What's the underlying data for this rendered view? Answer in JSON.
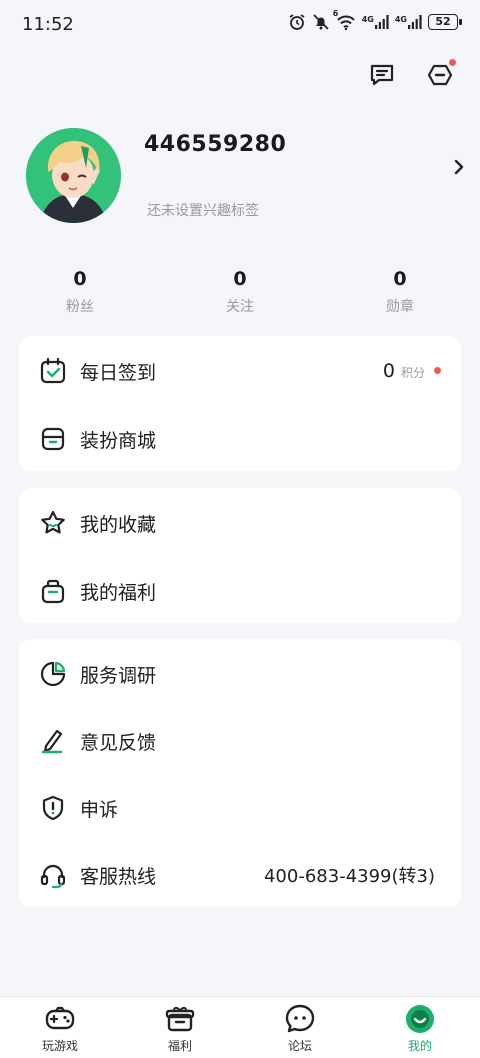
{
  "status_bar": {
    "time": "11:52",
    "battery": "52",
    "network_1": "4G",
    "network_2": "4G",
    "wifi_badge": "6"
  },
  "header": {
    "message_icon": "message-icon",
    "settings_icon": "settings-icon",
    "accent": "#18b06a",
    "badge_color": "#f05a55"
  },
  "profile": {
    "username": "446559280",
    "tagline": "还未设置兴趣标签",
    "avatar_bg": "#33c27a"
  },
  "stats": [
    {
      "value": "0",
      "label": "粉丝"
    },
    {
      "value": "0",
      "label": "关注"
    },
    {
      "value": "0",
      "label": "勋章"
    }
  ],
  "group1": {
    "checkin": {
      "label": "每日签到",
      "points": "0",
      "points_unit": "积分"
    },
    "dress": {
      "label": "装扮商城"
    }
  },
  "group2": {
    "favorites": {
      "label": "我的收藏"
    },
    "welfare": {
      "label": "我的福利"
    }
  },
  "group3": {
    "survey": {
      "label": "服务调研"
    },
    "feedback": {
      "label": "意见反馈"
    },
    "appeal": {
      "label": "申诉"
    },
    "hotline": {
      "label": "客服热线",
      "value": "400-683-4399(转3)"
    }
  },
  "tabs": [
    {
      "label": "玩游戏",
      "icon": "gamepad-icon"
    },
    {
      "label": "福利",
      "icon": "gift-icon"
    },
    {
      "label": "论坛",
      "icon": "forum-icon"
    },
    {
      "label": "我的",
      "icon": "me-icon",
      "active": true
    }
  ]
}
